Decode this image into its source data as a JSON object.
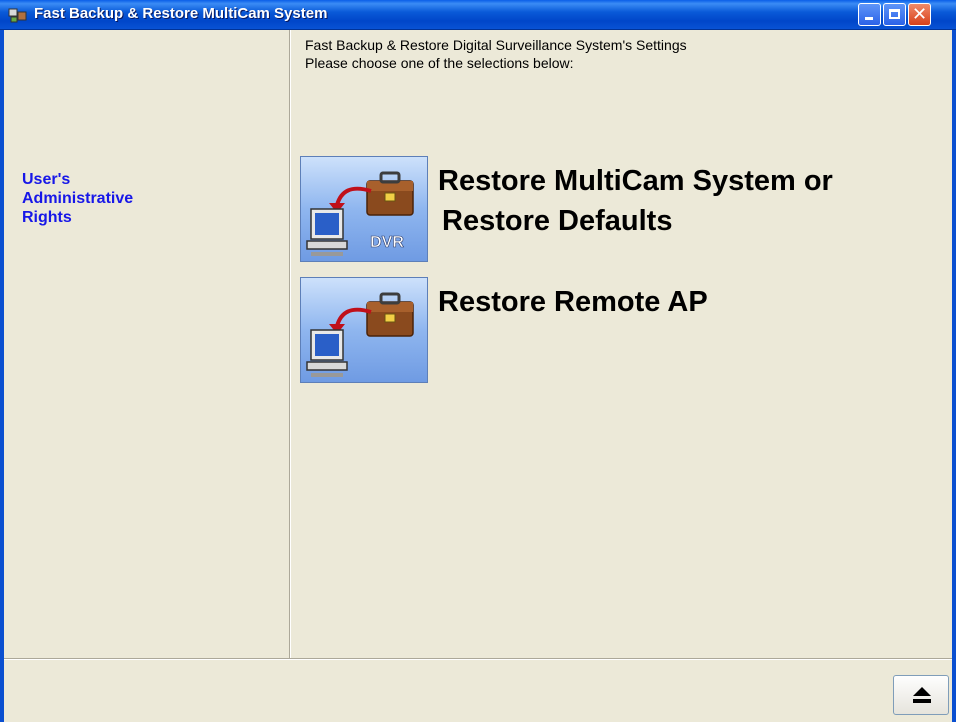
{
  "window": {
    "title": "Fast Backup & Restore MultiCam System"
  },
  "sidebar": {
    "link_lines": [
      "User's",
      "Administrative",
      "Rights"
    ]
  },
  "main": {
    "header_line1": "Fast Backup & Restore Digital Surveillance System's Settings",
    "header_line2": "Please choose one of the selections below:",
    "actions": [
      {
        "label_line1": "Restore MultiCam System or",
        "label_line2": " Restore Defaults",
        "icon_badge": "DVR",
        "icon": "restore-dvr-icon"
      },
      {
        "label_line1": "Restore Remote AP",
        "icon": "restore-remote-icon"
      }
    ]
  },
  "footer": {
    "eject_icon": "eject-icon"
  },
  "colors": {
    "titlebar": "#0a54d6",
    "link": "#1717e8",
    "background": "#ece9d8"
  }
}
